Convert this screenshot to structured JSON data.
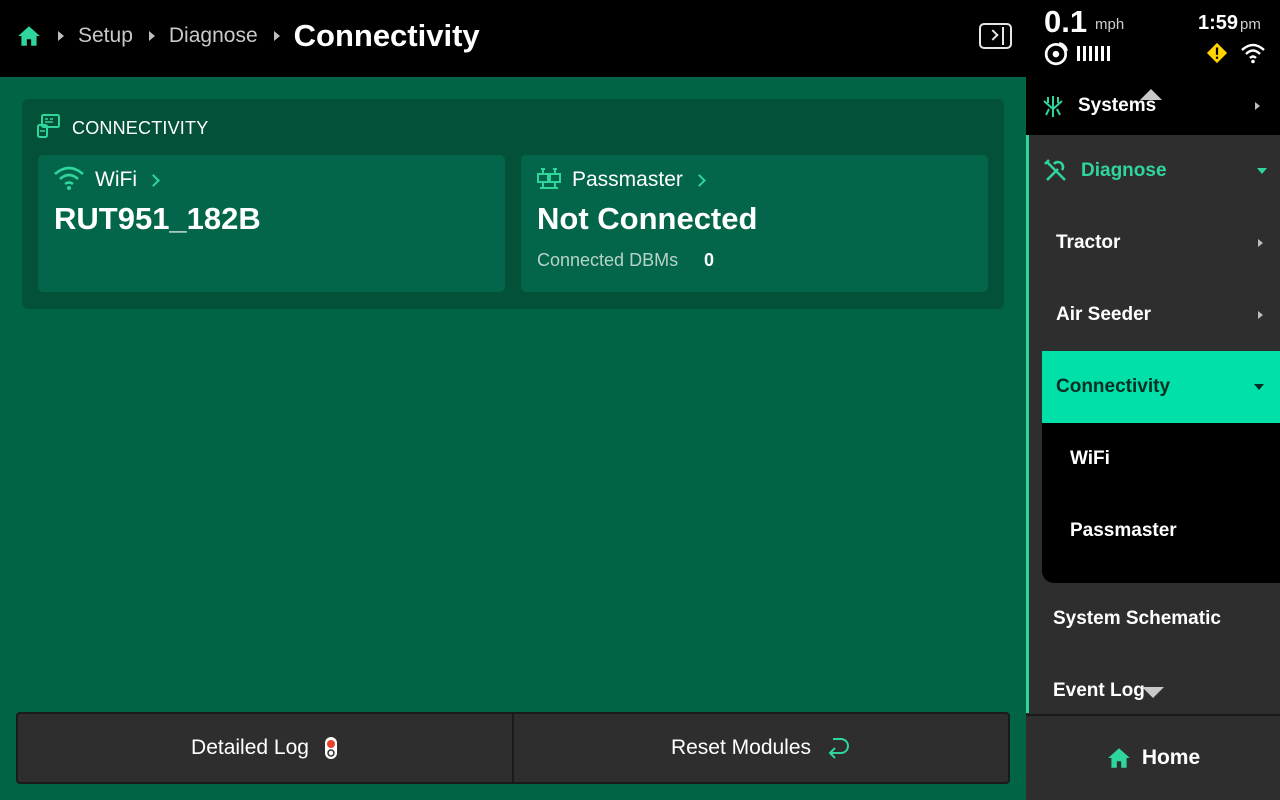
{
  "header": {
    "breadcrumbs": [
      "Setup",
      "Diagnose"
    ],
    "current": "Connectivity"
  },
  "status": {
    "speed": "0.1",
    "speed_unit": "mph",
    "time": "1:59",
    "time_suffix": "pm"
  },
  "card": {
    "title": "CONNECTIVITY",
    "wifi": {
      "label": "WiFi",
      "value": "RUT951_182B"
    },
    "passmaster": {
      "label": "Passmaster",
      "value": "Not Connected",
      "sub_label": "Connected DBMs",
      "sub_value": "0"
    }
  },
  "bottom_buttons": {
    "detailed_log": "Detailed Log",
    "reset_modules": "Reset Modules"
  },
  "sidebar": {
    "systems": "Systems",
    "diagnose": "Diagnose",
    "tractor": "Tractor",
    "air_seeder": "Air Seeder",
    "connectivity": "Connectivity",
    "wifi": "WiFi",
    "passmaster": "Passmaster",
    "system_schematic": "System Schematic",
    "event_log": "Event Log",
    "home": "Home"
  },
  "colors": {
    "accent": "#2ed69c",
    "main_bg": "#026446",
    "highlight": "#00e0a8"
  }
}
